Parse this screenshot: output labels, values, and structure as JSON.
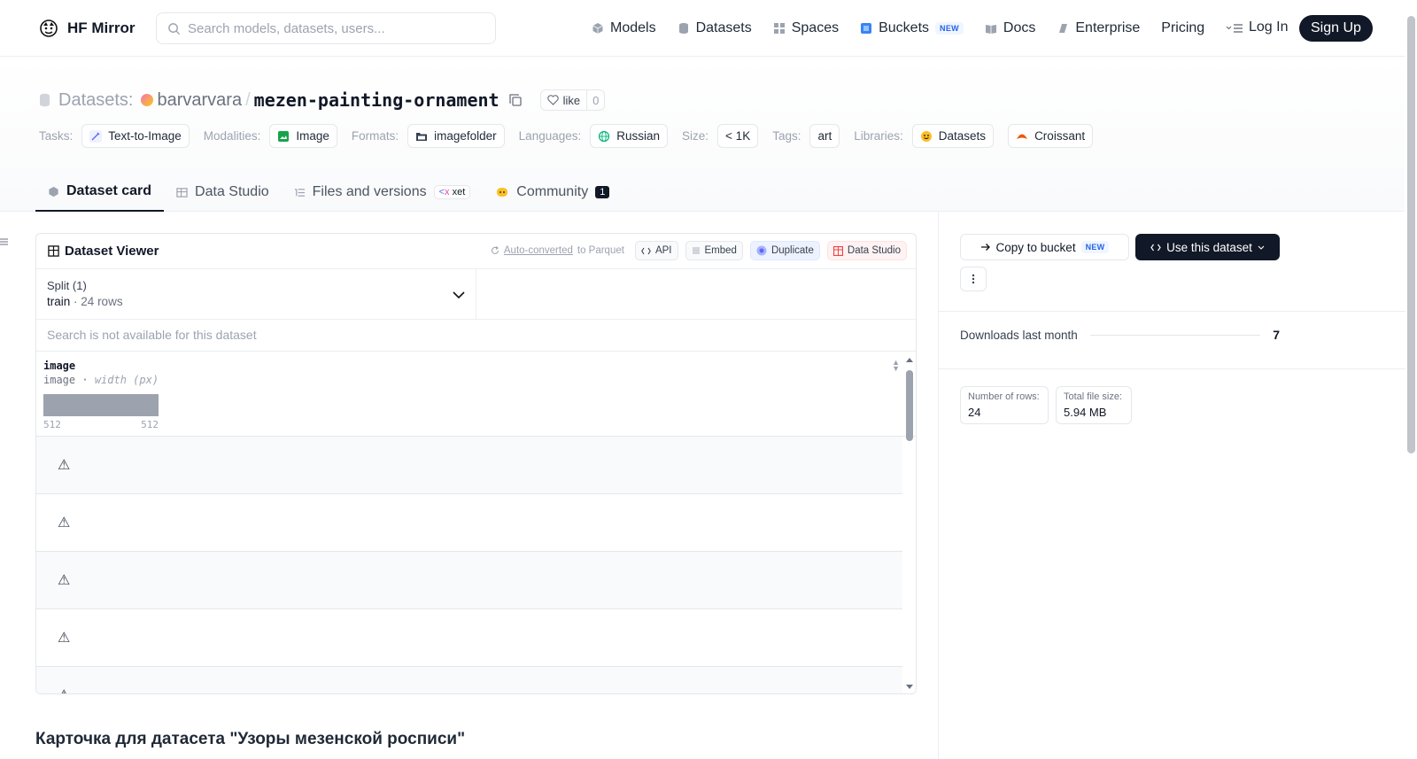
{
  "nav": {
    "brand": "HF Mirror",
    "search_placeholder": "Search models, datasets, users...",
    "links": {
      "models": "Models",
      "datasets": "Datasets",
      "spaces": "Spaces",
      "buckets": "Buckets",
      "buckets_badge": "NEW",
      "docs": "Docs",
      "enterprise": "Enterprise",
      "pricing": "Pricing"
    },
    "login": "Log In",
    "signup": "Sign Up"
  },
  "header": {
    "prefix": "Datasets:",
    "owner": "barvarvara",
    "separator": "/",
    "repo": "mezen-painting-ornament",
    "like_label": "like",
    "like_count": "0",
    "tags": {
      "tasks_label": "Tasks:",
      "tasks_value": "Text-to-Image",
      "modalities_label": "Modalities:",
      "modalities_value": "Image",
      "formats_label": "Formats:",
      "formats_value": "imagefolder",
      "languages_label": "Languages:",
      "languages_value": "Russian",
      "size_label": "Size:",
      "size_value": "< 1K",
      "tags_label": "Tags:",
      "tags_value": "art",
      "libraries_label": "Libraries:",
      "libraries_value_1": "Datasets",
      "libraries_value_2": "Croissant"
    },
    "tabs": {
      "card": "Dataset card",
      "studio": "Data Studio",
      "files": "Files and versions",
      "files_badge": "xet",
      "community": "Community",
      "community_count": "1"
    }
  },
  "viewer": {
    "title": "Dataset Viewer",
    "auto_converted_link": "Auto-converted",
    "auto_converted_rest": "to Parquet",
    "btn_api": "API",
    "btn_embed": "Embed",
    "btn_duplicate": "Duplicate",
    "btn_studio": "Data Studio",
    "split_label": "Split (1)",
    "split_name": "train",
    "split_dot": "·",
    "split_rows": "24 rows",
    "search_disabled": "Search is not available for this dataset",
    "column": {
      "name": "image",
      "type": "image",
      "type_dot": "·",
      "type_detail": "width (px)",
      "hist_min": "512",
      "hist_max": "512"
    },
    "row_symbol": "⚠"
  },
  "sidebar": {
    "copy_bucket": "Copy to bucket",
    "copy_bucket_badge": "NEW",
    "use_dataset": "Use this dataset",
    "downloads_label": "Downloads last month",
    "downloads_value": "7",
    "rows_label": "Number of rows:",
    "rows_value": "24",
    "size_label": "Total file size:",
    "size_value": "5.94 MB"
  },
  "card_title": "Карточка для датасета \"Узоры мезенской росписи\""
}
